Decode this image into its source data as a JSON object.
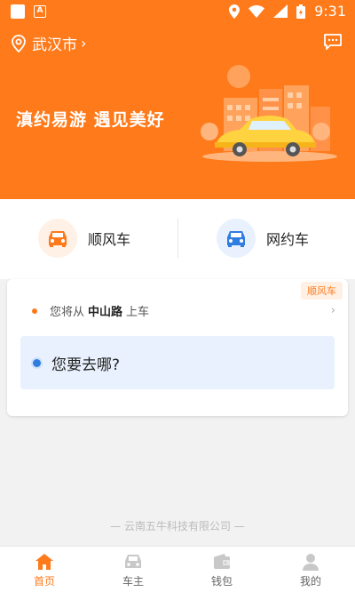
{
  "status_bar": {
    "time": "9:31"
  },
  "header": {
    "city": "武汉市",
    "slogan": "滇约易游  遇见美好"
  },
  "services": [
    {
      "label": "顺风车",
      "color": "#ff7a1a",
      "bg": "#fff1e6"
    },
    {
      "label": "网约车",
      "color": "#2f7de1",
      "bg": "#e8f1fd"
    }
  ],
  "trip_card": {
    "tag": "顺风车",
    "pickup_prefix": "您将从",
    "pickup_place": "中山路",
    "pickup_suffix": "上车",
    "destination_placeholder": "您要去哪?"
  },
  "footer_text": "— 云南五牛科技有限公司 —",
  "tabs": [
    {
      "label": "首页",
      "active": true
    },
    {
      "label": "车主",
      "active": false
    },
    {
      "label": "钱包",
      "active": false
    },
    {
      "label": "我的",
      "active": false
    }
  ],
  "colors": {
    "accent": "#ff7a1a",
    "blue": "#2f7de1"
  }
}
